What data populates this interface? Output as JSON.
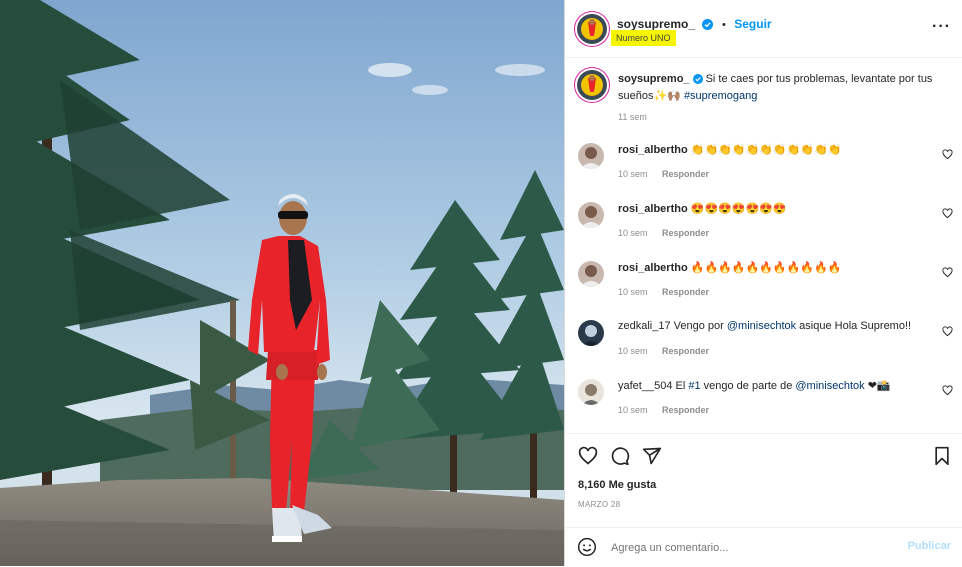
{
  "post": {
    "username": "soysupremo_",
    "follow_label": "Seguir",
    "separator": "•",
    "location": "Numero UNO",
    "more_label": "···"
  },
  "caption": {
    "username": "soysupremo_",
    "text": "Si te caes por tus problemas, levantate por tus sueños✨🙌🏽",
    "hashtag": "#supremogang",
    "time": "11 sem"
  },
  "comments": [
    {
      "username": "rosi_albertho",
      "text": "👏👏👏👏👏👏👏👏👏👏👏",
      "time": "10 sem",
      "reply_label": "Responder"
    },
    {
      "username": "rosi_albertho",
      "text": "😍😍😍😍😍😍😍",
      "time": "10 sem",
      "reply_label": "Responder"
    },
    {
      "username": "rosi_albertho",
      "text": "🔥🔥🔥🔥🔥🔥🔥🔥🔥🔥🔥",
      "time": "10 sem",
      "reply_label": "Responder"
    },
    {
      "username": "zedkali_17",
      "text_pre": "Vengo por ",
      "mention": "@minisechtok",
      "text_post": " asique Hola Supremo!!",
      "time": "10 sem",
      "reply_label": "Responder"
    },
    {
      "username": "yafet__504",
      "text_pre": "El ",
      "hashtag": "#1",
      "text_mid": " vengo de parte de ",
      "mention": "@minisechtok",
      "text_post": " ❤📸",
      "time": "10 sem",
      "reply_label": "Responder"
    }
  ],
  "stats": {
    "likes": "8,160 Me gusta",
    "date": "MARZO 28"
  },
  "add_comment": {
    "placeholder": "Agrega un comentario...",
    "publish_label": "Publicar"
  },
  "colors": {
    "accent_blue": "#0095f6",
    "link_blue": "#00376b",
    "highlight": "#f5f500",
    "suit_red": "#e8232a"
  },
  "icons": [
    "verified-badge-icon",
    "more-options-icon",
    "like-heart-icon",
    "comment-icon",
    "share-icon",
    "save-bookmark-icon",
    "emoji-icon"
  ]
}
